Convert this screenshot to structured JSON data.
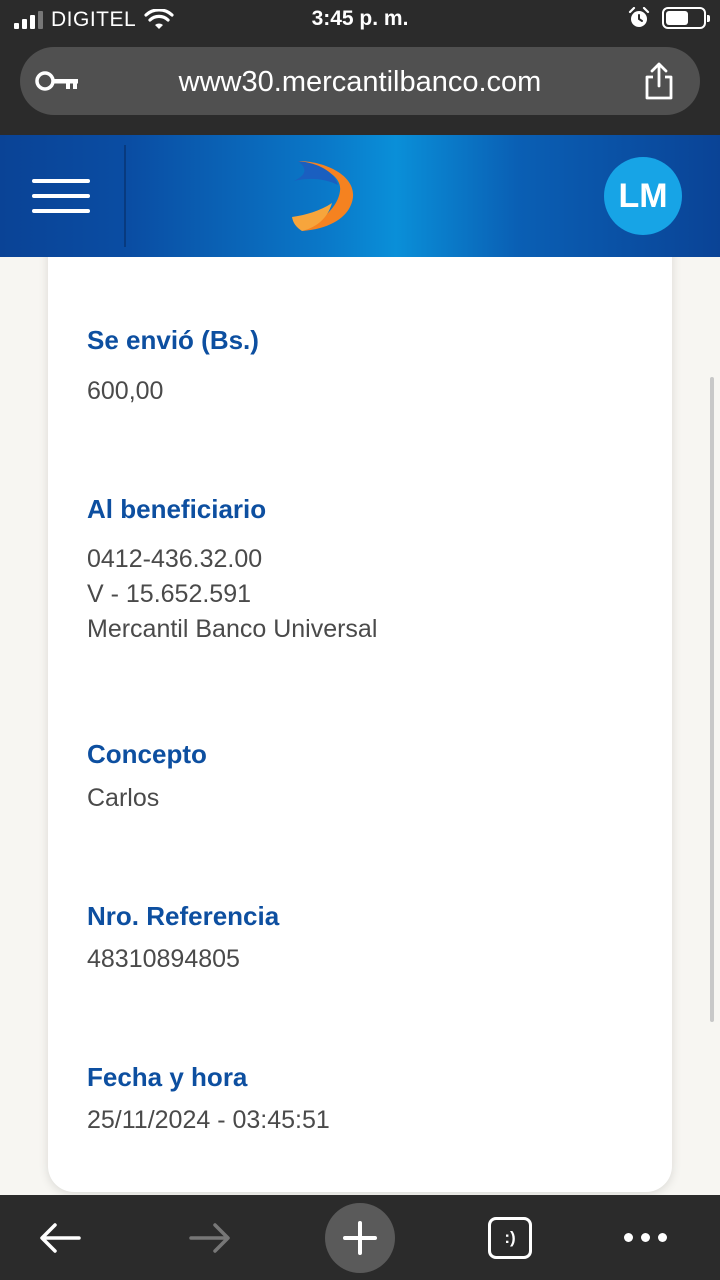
{
  "status_bar": {
    "carrier": "DIGITEL",
    "time": "3:45 p. m.",
    "battery_level": 0.62
  },
  "browser": {
    "url": "www30.mercantilbanco.com"
  },
  "header": {
    "avatar_initials": "LM",
    "colors": {
      "primary": "#0a4396",
      "accent": "#17a4e6",
      "logo_orange": "#f58220"
    }
  },
  "receipt": {
    "amount_label": "Se envió (Bs.)",
    "amount_value": "600,00",
    "beneficiary_label": "Al beneficiario",
    "beneficiary_phone": "0412-436.32.00",
    "beneficiary_id": "V - 15.652.591",
    "beneficiary_bank": "Mercantil Banco Universal",
    "concept_label": "Concepto",
    "concept_value": "Carlos",
    "reference_label": "Nro. Referencia",
    "reference_value": "48310894805",
    "datetime_label": "Fecha y hora",
    "datetime_value": "25/11/2024 - 03:45:51"
  },
  "toolbar": {
    "tabs_label": ":)",
    "icons": [
      "back-arrow-icon",
      "forward-arrow-icon",
      "plus-icon",
      "tabs-icon",
      "more-icon"
    ]
  }
}
